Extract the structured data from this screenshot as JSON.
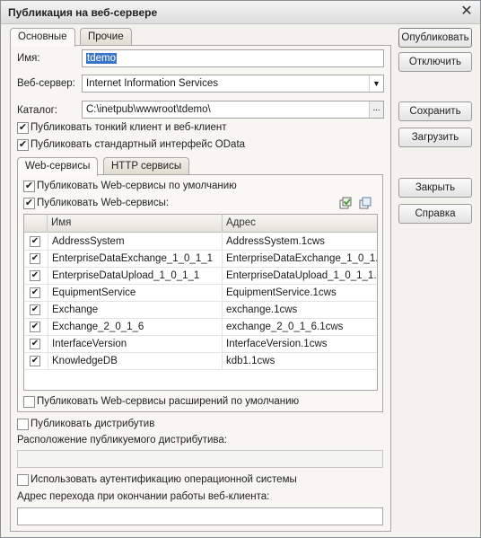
{
  "window": {
    "title": "Публикация на веб-сервере",
    "close_glyph": "✕"
  },
  "tabs": [
    {
      "label": "Основные",
      "active": true
    },
    {
      "label": "Прочие",
      "active": false
    }
  ],
  "form": {
    "name_label": "Имя:",
    "name_value": "tdemo",
    "webserver_label": "Веб-сервер:",
    "webserver_value": "Internet Information Services",
    "catalog_label": "Каталог:",
    "catalog_value": "C:\\inetpub\\wwwroot\\tdemo\\",
    "catalog_button": "...",
    "publish_thin_client": {
      "label": "Публиковать тонкий клиент и веб-клиент",
      "checked": true
    },
    "publish_odata": {
      "label": "Публиковать стандартный интерфейс OData",
      "checked": true
    }
  },
  "subtabs": [
    {
      "label": "Web-сервисы",
      "active": true
    },
    {
      "label": "HTTP сервисы",
      "active": false
    }
  ],
  "webservices": {
    "publish_default": {
      "label": "Публиковать Web-сервисы по умолчанию",
      "checked": true
    },
    "publish_ws": {
      "label": "Публиковать Web-сервисы:",
      "checked": true
    },
    "columns": [
      "Имя",
      "Адрес"
    ],
    "rows": [
      {
        "checked": true,
        "name": "AddressSystem",
        "address": "AddressSystem.1cws"
      },
      {
        "checked": true,
        "name": "EnterpriseDataExchange_1_0_1_1",
        "address": "EnterpriseDataExchange_1_0_1..."
      },
      {
        "checked": true,
        "name": "EnterpriseDataUpload_1_0_1_1",
        "address": "EnterpriseDataUpload_1_0_1_1..."
      },
      {
        "checked": true,
        "name": "EquipmentService",
        "address": "EquipmentService.1cws"
      },
      {
        "checked": true,
        "name": "Exchange",
        "address": "exchange.1cws"
      },
      {
        "checked": true,
        "name": "Exchange_2_0_1_6",
        "address": "exchange_2_0_1_6.1cws"
      },
      {
        "checked": true,
        "name": "InterfaceVersion",
        "address": "InterfaceVersion.1cws"
      },
      {
        "checked": true,
        "name": "KnowledgeDB",
        "address": "kdb1.1cws"
      }
    ],
    "publish_extensions": {
      "label": "Публиковать Web-сервисы расширений по умолчанию",
      "checked": false
    }
  },
  "distribution": {
    "publish_distrib": {
      "label": "Публиковать дистрибутив",
      "checked": false
    },
    "location_label": "Расположение публикуемого дистрибутива:",
    "location_value": ""
  },
  "auth": {
    "use_os_auth": {
      "label": "Использовать аутентификацию операционной системы",
      "checked": false
    },
    "exit_url_label": "Адрес перехода при окончании работы веб-клиента:",
    "exit_url_value": ""
  },
  "buttons": {
    "publish": "Опубликовать",
    "disable": "Отключить",
    "save": "Сохранить",
    "load": "Загрузить",
    "close": "Закрыть",
    "help": "Справка"
  },
  "icons": {
    "check_all": "check-all-icon",
    "uncheck_all": "uncheck-all-icon",
    "accent_green": "#3c9a2e",
    "accent_blue": "#3a74c8"
  }
}
